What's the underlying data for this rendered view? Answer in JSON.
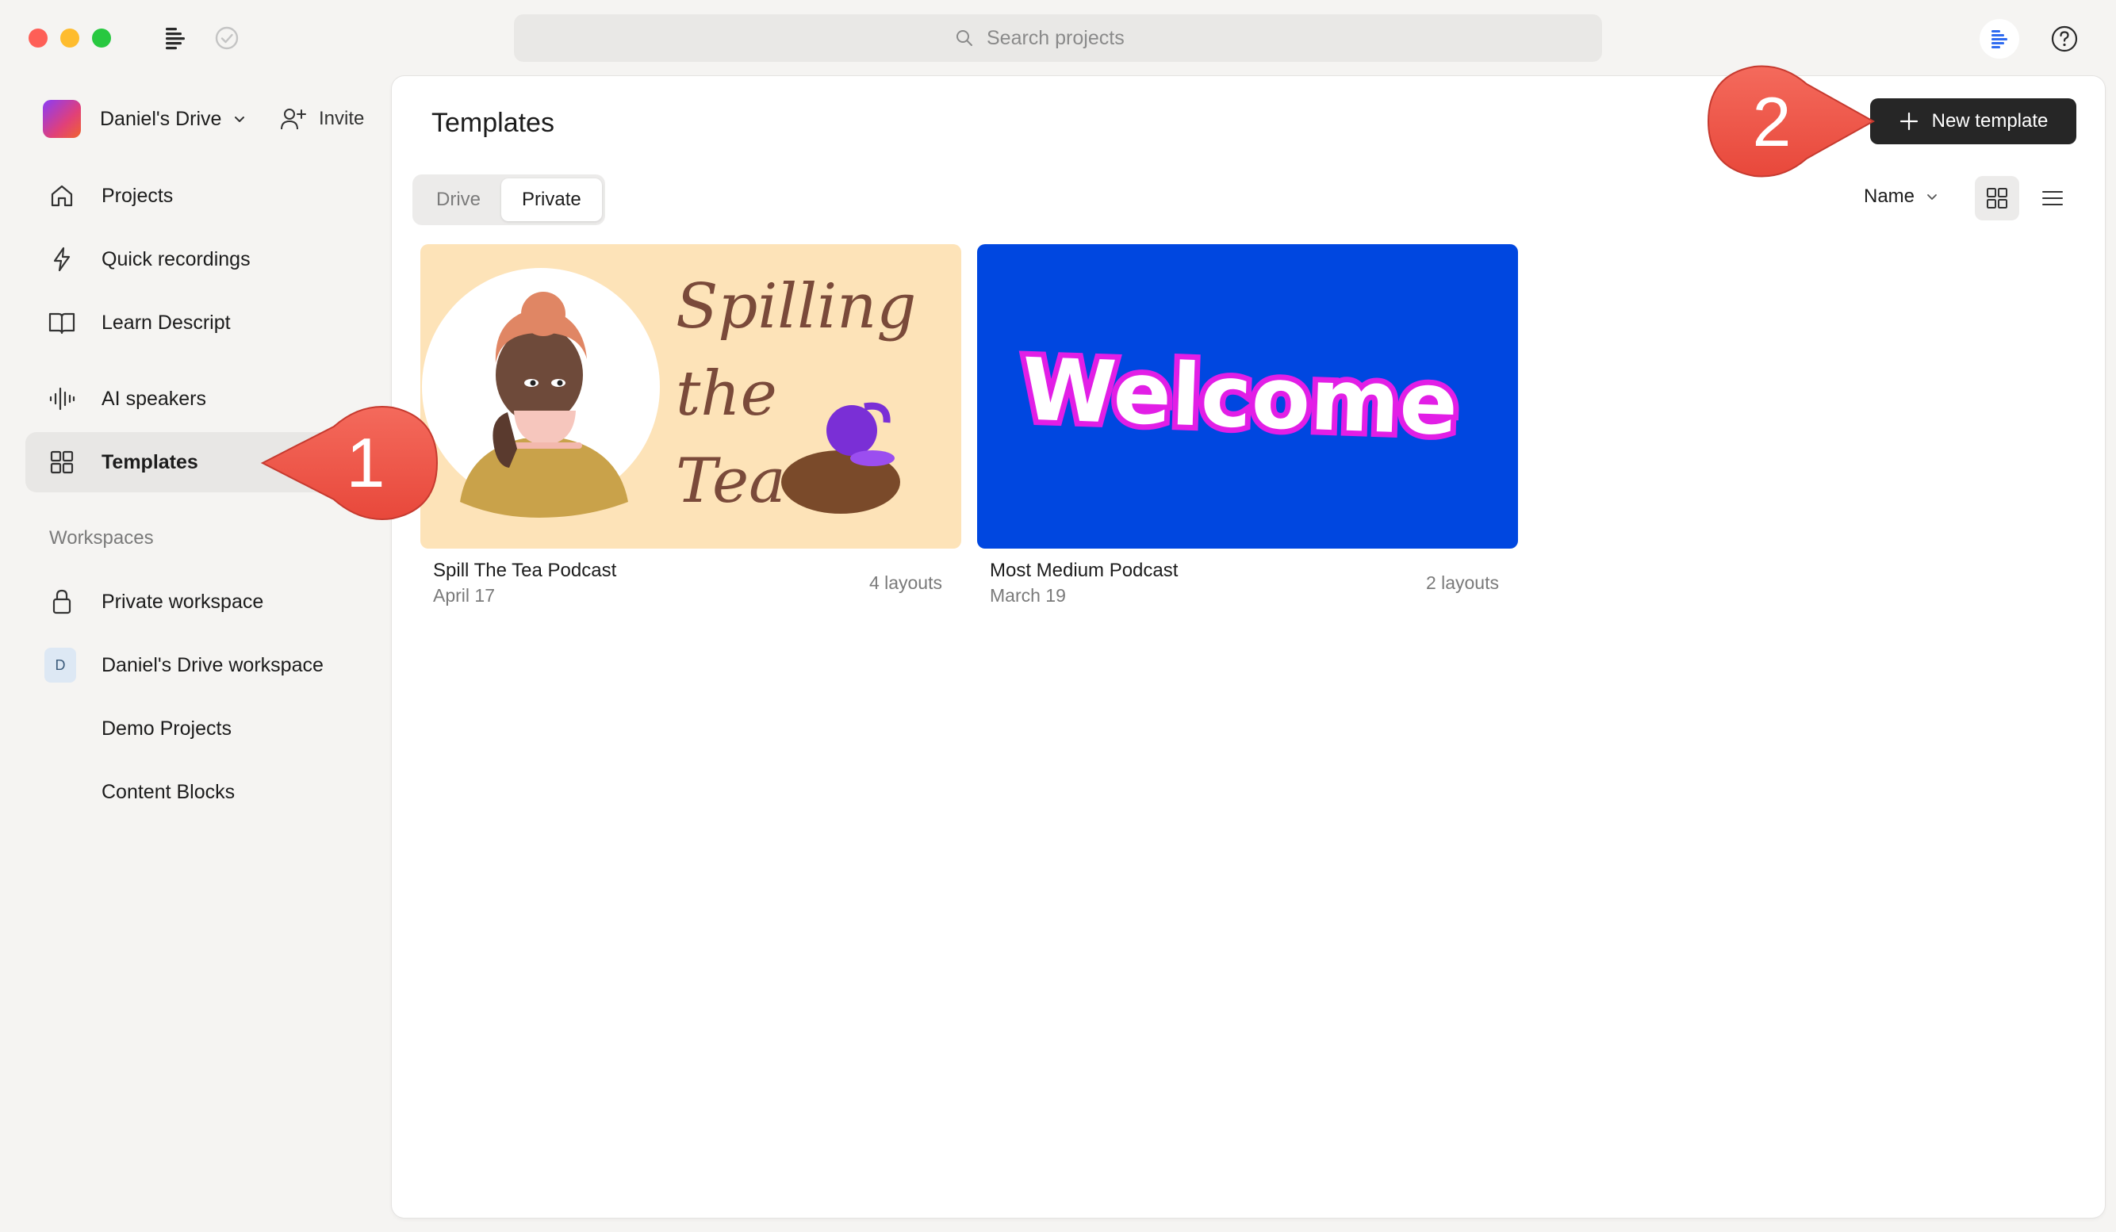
{
  "window": {
    "search_placeholder": "Search projects"
  },
  "sidebar": {
    "drive_name": "Daniel's Drive",
    "invite_label": "Invite",
    "items": [
      {
        "label": "Projects",
        "icon": "home-icon"
      },
      {
        "label": "Quick recordings",
        "icon": "lightning-icon"
      },
      {
        "label": "Learn Descript",
        "icon": "book-icon"
      },
      {
        "label": "AI speakers",
        "icon": "waveform-icon"
      },
      {
        "label": "Templates",
        "icon": "grid-icon",
        "active": true
      }
    ],
    "workspaces_heading": "Workspaces",
    "workspaces": [
      {
        "label": "Private workspace",
        "icon": "lock-icon"
      },
      {
        "label": "Daniel's Drive workspace",
        "badge": "D"
      },
      {
        "label": "Demo Projects"
      },
      {
        "label": "Content Blocks"
      }
    ]
  },
  "main": {
    "title": "Templates",
    "new_template_label": "New template",
    "tabs": [
      {
        "label": "Drive",
        "selected": false
      },
      {
        "label": "Private",
        "selected": true
      }
    ],
    "sort_label": "Name",
    "templates": [
      {
        "name": "Spill The Tea Podcast",
        "date": "April 17",
        "layouts": "4 layouts",
        "thumbnail_text": [
          "Spilling",
          "the",
          "Tea"
        ]
      },
      {
        "name": "Most Medium Podcast",
        "date": "March 19",
        "layouts": "2 layouts",
        "thumbnail_text": "Welcome"
      }
    ]
  },
  "annotations": [
    {
      "label": "1"
    },
    {
      "label": "2"
    }
  ],
  "colors": {
    "active_nav_bg": "#e8e7e5",
    "primary_button": "#262626",
    "callout": "#f0574a",
    "welcome_bg": "#0047e0",
    "tea_bg": "#fde3b8"
  }
}
